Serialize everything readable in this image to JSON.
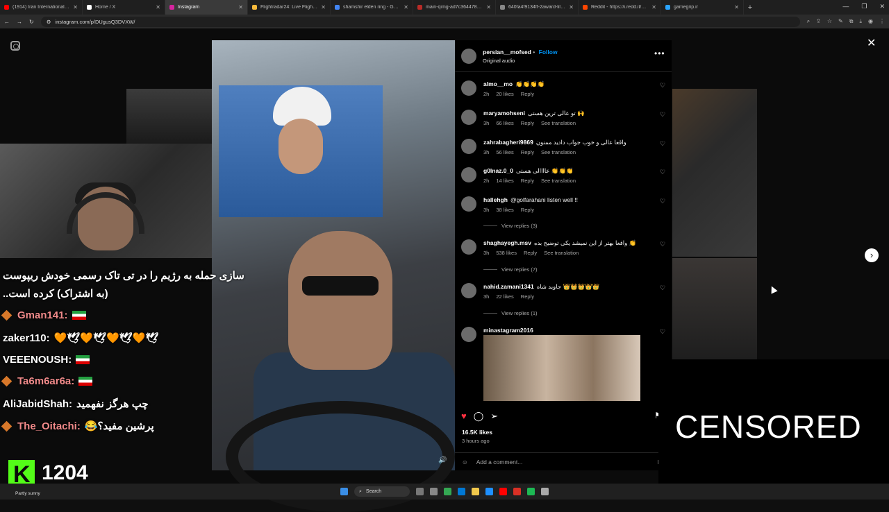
{
  "browser": {
    "tabs": [
      {
        "title": "(1914) Iran International - YouTu",
        "color": "#ff0000"
      },
      {
        "title": "Home / X",
        "color": "#ffffff"
      },
      {
        "title": "Instagram",
        "color": "#d6249f",
        "active": true
      },
      {
        "title": "Flightradar24: Live Flight Tracke",
        "color": "#f6b93b"
      },
      {
        "title": "shamshir elden ring - Google Se",
        "color": "#4285f4"
      },
      {
        "title": "main-qimg-ad7c364478dfe790c",
        "color": "#b92b27"
      },
      {
        "title": "640fa4f9134ff-2award-lil-04.jpg",
        "color": "#888888"
      },
      {
        "title": "Reddit - https://i.redd.it/svg4js...",
        "color": "#ff4500"
      },
      {
        "title": "gamegrip.ir",
        "color": "#2aa4ff"
      }
    ],
    "url": "instagram.com/p/DUgusQ3DVXW/"
  },
  "post": {
    "username": "persian__mofsed",
    "follow_label": "Follow",
    "audio": "Original audio",
    "likes": "16.5K likes",
    "time_ago": "3 hours ago",
    "add_comment_placeholder": "Add a comment...",
    "post_label": "Po"
  },
  "comments": [
    {
      "user": "almo__mo",
      "text": "👏👏👏👏",
      "time": "2h",
      "likes": "20 likes",
      "reply": "Reply",
      "translate": ""
    },
    {
      "user": "maryamohseni",
      "text": "تو عالی ترین هستی 🙌",
      "time": "3h",
      "likes": "66 likes",
      "reply": "Reply",
      "translate": "See translation"
    },
    {
      "user": "zahrabagheri9869",
      "text": "واقعا عالی و خوب جواب دادید ممنون",
      "time": "3h",
      "likes": "56 likes",
      "reply": "Reply",
      "translate": "See translation"
    },
    {
      "user": "g0lnaz.0_0",
      "text": "عاااالی هستی 👏👏👏",
      "time": "2h",
      "likes": "14 likes",
      "reply": "Reply",
      "translate": "See translation"
    },
    {
      "user": "hallehgh",
      "text": "@golfarahani listen well !!",
      "time": "3h",
      "likes": "38 likes",
      "reply": "Reply",
      "translate": "",
      "replies": "View replies (3)"
    },
    {
      "user": "shaghayegh.msv",
      "text": "واقعا بهتر از این نمیشد یکی توضیح بده 👏",
      "time": "3h",
      "likes": "538 likes",
      "reply": "Reply",
      "translate": "See translation",
      "replies": "View replies (7)"
    },
    {
      "user": "nahid.zamani1341",
      "text": "جاوید شاه 👑👑👑👑👑",
      "time": "3h",
      "likes": "22 likes",
      "reply": "Reply",
      "translate": "",
      "replies": "View replies (1)"
    },
    {
      "user": "minastagram2016",
      "text": "",
      "time": "",
      "likes": "",
      "reply": "",
      "translate": ""
    }
  ],
  "stream": {
    "chat": [
      {
        "user": "",
        "text": "سازی حمله به رژیم را در تی تاک رسمی خودش ریپوست"
      },
      {
        "user": "",
        "text": "(به اشتراک) کرده است.."
      },
      {
        "user": "Gman141:",
        "text": "",
        "flag": true,
        "badge": true
      },
      {
        "user": "zaker110:",
        "text": "🕊🧡🕊🧡🕊🧡🕊🧡"
      },
      {
        "user": "VEEENOUSH:",
        "text": "",
        "flag": true
      },
      {
        "user": "Ta6m6ar6a:",
        "text": "",
        "flag": true,
        "badge": true
      },
      {
        "user": "AliJabidShah:",
        "text": "چپ هرگز نفهمید"
      },
      {
        "user": "The_Oitachi:",
        "text": "پرشین مفید؟😂",
        "badge": true
      }
    ],
    "viewer_count": "1204",
    "censored_label": "CENSORED"
  },
  "taskbar": {
    "search_label": "Search",
    "weather": "Partly sunny"
  }
}
